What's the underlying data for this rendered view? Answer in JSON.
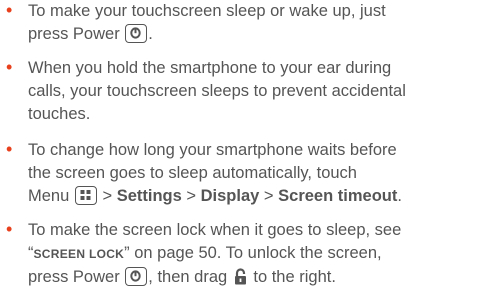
{
  "bullets": [
    {
      "line1": "To make your touchscreen sleep or wake up, just",
      "line2_pre": "press Power",
      "line2_post": "."
    },
    {
      "line1": "When you hold the smartphone to your ear during",
      "line2": "calls, your touchscreen sleeps to prevent accidental",
      "line3": "touches."
    },
    {
      "line1": "To change how long your smartphone waits before",
      "line2": "the screen goes to sleep automatically, touch",
      "line3_menu": "Menu",
      "sep": ">",
      "settings": "Settings",
      "display": "Display",
      "screen_timeout": "Screen timeout",
      "end": "."
    },
    {
      "line1_pre": "To make the screen lock when it goes to sleep, see",
      "quote_open": "“",
      "link": "SCREEN LOCK",
      "quote_close": "”",
      "line2_post": " on page 50. To unlock the screen,",
      "line3_pre": "press Power",
      "line3_mid": ", then drag",
      "line3_post": "to the right."
    }
  ],
  "icons": {
    "power": "power-key-icon",
    "menu": "menu-key-icon",
    "lock": "unlock-icon"
  },
  "colors": {
    "bullet": "#e8401c",
    "text": "#555555"
  }
}
